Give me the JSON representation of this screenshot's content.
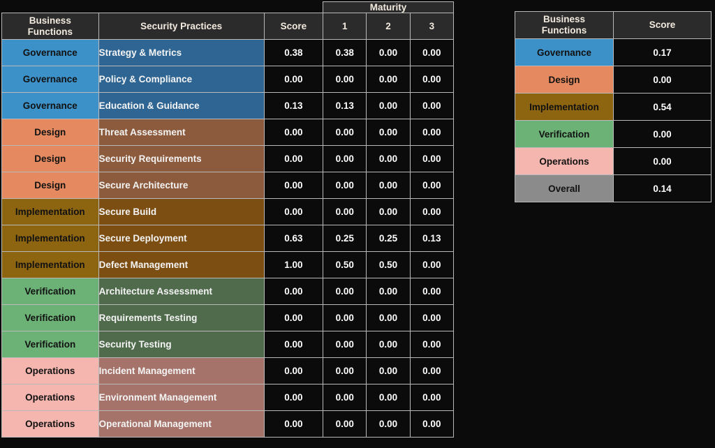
{
  "main_table": {
    "group_header": "Maturity",
    "headers": {
      "business_functions": "Business\nFunctions",
      "business_functions_line1": "Business",
      "business_functions_line2": "Functions",
      "security_practices": "Security Practices",
      "score": "Score",
      "m1": "1",
      "m2": "2",
      "m3": "3"
    },
    "rows": [
      {
        "function": "Governance",
        "practice": "Strategy & Metrics",
        "score": "0.38",
        "m1": "0.38",
        "m2": "0.00",
        "m3": "0.00",
        "fn_class": "fn-governance",
        "sp_class": "sp-governance"
      },
      {
        "function": "Governance",
        "practice": "Policy & Compliance",
        "score": "0.00",
        "m1": "0.00",
        "m2": "0.00",
        "m3": "0.00",
        "fn_class": "fn-governance",
        "sp_class": "sp-governance"
      },
      {
        "function": "Governance",
        "practice": "Education & Guidance",
        "score": "0.13",
        "m1": "0.13",
        "m2": "0.00",
        "m3": "0.00",
        "fn_class": "fn-governance",
        "sp_class": "sp-governance"
      },
      {
        "function": "Design",
        "practice": "Threat Assessment",
        "score": "0.00",
        "m1": "0.00",
        "m2": "0.00",
        "m3": "0.00",
        "fn_class": "fn-design",
        "sp_class": "sp-design"
      },
      {
        "function": "Design",
        "practice": "Security Requirements",
        "score": "0.00",
        "m1": "0.00",
        "m2": "0.00",
        "m3": "0.00",
        "fn_class": "fn-design",
        "sp_class": "sp-design"
      },
      {
        "function": "Design",
        "practice": "Secure Architecture",
        "score": "0.00",
        "m1": "0.00",
        "m2": "0.00",
        "m3": "0.00",
        "fn_class": "fn-design",
        "sp_class": "sp-design"
      },
      {
        "function": "Implementation",
        "practice": "Secure Build",
        "score": "0.00",
        "m1": "0.00",
        "m2": "0.00",
        "m3": "0.00",
        "fn_class": "fn-implementation",
        "sp_class": "sp-implementation"
      },
      {
        "function": "Implementation",
        "practice": "Secure Deployment",
        "score": "0.63",
        "m1": "0.25",
        "m2": "0.25",
        "m3": "0.13",
        "fn_class": "fn-implementation",
        "sp_class": "sp-implementation"
      },
      {
        "function": "Implementation",
        "practice": "Defect Management",
        "score": "1.00",
        "m1": "0.50",
        "m2": "0.50",
        "m3": "0.00",
        "fn_class": "fn-implementation",
        "sp_class": "sp-implementation"
      },
      {
        "function": "Verification",
        "practice": "Architecture Assessment",
        "score": "0.00",
        "m1": "0.00",
        "m2": "0.00",
        "m3": "0.00",
        "fn_class": "fn-verification",
        "sp_class": "sp-verification"
      },
      {
        "function": "Verification",
        "practice": "Requirements Testing",
        "score": "0.00",
        "m1": "0.00",
        "m2": "0.00",
        "m3": "0.00",
        "fn_class": "fn-verification",
        "sp_class": "sp-verification"
      },
      {
        "function": "Verification",
        "practice": "Security Testing",
        "score": "0.00",
        "m1": "0.00",
        "m2": "0.00",
        "m3": "0.00",
        "fn_class": "fn-verification",
        "sp_class": "sp-verification"
      },
      {
        "function": "Operations",
        "practice": "Incident Management",
        "score": "0.00",
        "m1": "0.00",
        "m2": "0.00",
        "m3": "0.00",
        "fn_class": "fn-operations",
        "sp_class": "sp-operations"
      },
      {
        "function": "Operations",
        "practice": "Environment Management",
        "score": "0.00",
        "m1": "0.00",
        "m2": "0.00",
        "m3": "0.00",
        "fn_class": "fn-operations",
        "sp_class": "sp-operations"
      },
      {
        "function": "Operations",
        "practice": "Operational Management",
        "score": "0.00",
        "m1": "0.00",
        "m2": "0.00",
        "m3": "0.00",
        "fn_class": "fn-operations",
        "sp_class": "sp-operations"
      }
    ]
  },
  "summary_table": {
    "headers": {
      "business_functions_line1": "Business",
      "business_functions_line2": "Functions",
      "score": "Score"
    },
    "rows": [
      {
        "function": "Governance",
        "score": "0.17",
        "fn_class": "fn-governance"
      },
      {
        "function": "Design",
        "score": "0.00",
        "fn_class": "fn-design"
      },
      {
        "function": "Implementation",
        "score": "0.54",
        "fn_class": "fn-implementation"
      },
      {
        "function": "Verification",
        "score": "0.00",
        "fn_class": "fn-verification"
      },
      {
        "function": "Operations",
        "score": "0.00",
        "fn_class": "fn-operations"
      },
      {
        "function": "Overall",
        "score": "0.14",
        "fn_class": "fn-overall"
      }
    ]
  },
  "colors": {
    "background": "#0b0b0b",
    "grid_line": "#b9b9b9",
    "header_bg": "#2b2b2b",
    "header_text": "#f2eadf",
    "governance": "#3c91c9",
    "design": "#e58a60",
    "implementation": "#8d6410",
    "verification": "#6cb176",
    "operations": "#f4b6ae",
    "overall": "#8b8b8b"
  }
}
